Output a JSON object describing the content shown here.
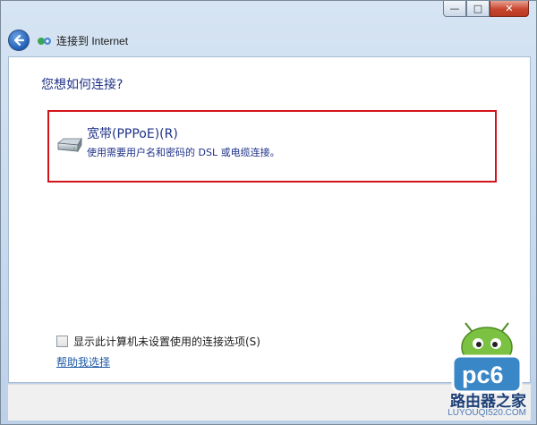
{
  "window": {
    "title": "连接到 Internet",
    "buttons": {
      "minimize": "—",
      "maximize": "□",
      "close": "✕"
    }
  },
  "main": {
    "question": "您想如何连接?",
    "option": {
      "icon": "modem-icon",
      "title": "宽带(PPPoE)(R)",
      "description": "使用需要用户名和密码的 DSL 或电缆连接。"
    },
    "show_options_checkbox": {
      "label": "显示此计算机未设置使用的连接选项(S)",
      "checked": false
    },
    "help_link": "帮助我选择"
  },
  "watermark": {
    "logo": "pc6",
    "text": "路由器之家",
    "url": "LUYOUQI520.COM"
  },
  "colors": {
    "highlight_border": "#d4121b",
    "link": "#1f5aa6",
    "heading": "#1e3287"
  }
}
